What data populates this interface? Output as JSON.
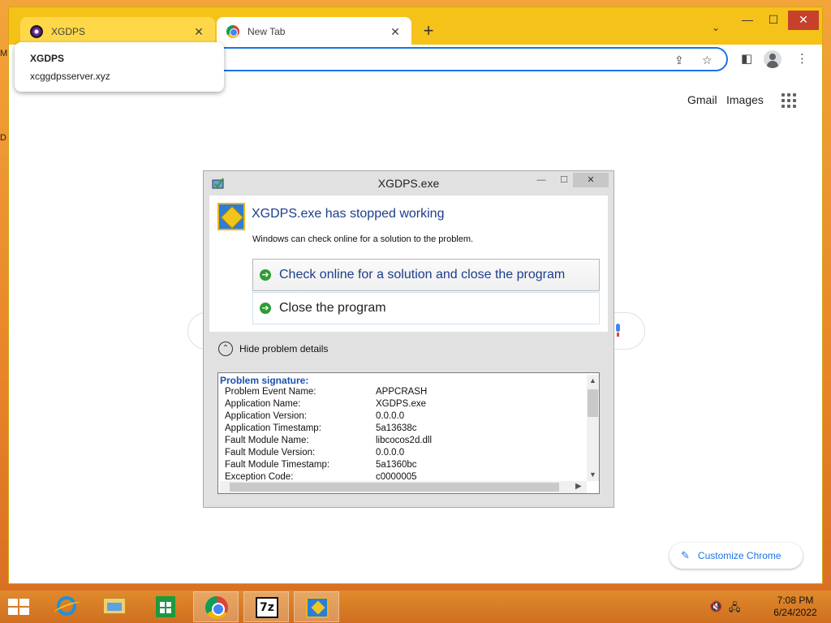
{
  "desktop": {
    "letters": [
      "M",
      "D"
    ]
  },
  "browser": {
    "tabs": [
      {
        "title": "XGDPS",
        "favicon": "xgdps-favicon",
        "active": false
      },
      {
        "title": "New Tab",
        "favicon": "chrome-favicon",
        "active": true
      }
    ],
    "hovercard": {
      "title": "XGDPS",
      "url": "xcggdpsserver.xyz"
    },
    "newtab": {
      "links": [
        "Gmail",
        "Images"
      ],
      "customize_label": "Customize Chrome"
    },
    "accent": "#1a73e8"
  },
  "dialog": {
    "title": "XGDPS.exe",
    "heading": "XGDPS.exe has stopped working",
    "subtext": "Windows can check online for a solution to the problem.",
    "options": [
      "Check online for a solution and close the program",
      "Close the program"
    ],
    "details_toggle": "Hide problem details",
    "signature": {
      "header": "Problem signature:",
      "rows": [
        {
          "key": "Problem Event Name:",
          "value": "APPCRASH"
        },
        {
          "key": "Application Name:",
          "value": "XGDPS.exe"
        },
        {
          "key": "Application Version:",
          "value": "0.0.0.0"
        },
        {
          "key": "Application Timestamp:",
          "value": "5a13638c"
        },
        {
          "key": "Fault Module Name:",
          "value": "libcocos2d.dll"
        },
        {
          "key": "Fault Module Version:",
          "value": "0.0.0.0"
        },
        {
          "key": "Fault Module Timestamp:",
          "value": "5a1360bc"
        },
        {
          "key": "Exception Code:",
          "value": "c0000005"
        }
      ]
    }
  },
  "taskbar": {
    "apps": [
      "internet-explorer",
      "file-explorer",
      "store",
      "chrome",
      "7-zip",
      "problem-reporting"
    ],
    "clock": {
      "time": "7:08 PM",
      "date": "6/24/2022"
    }
  }
}
